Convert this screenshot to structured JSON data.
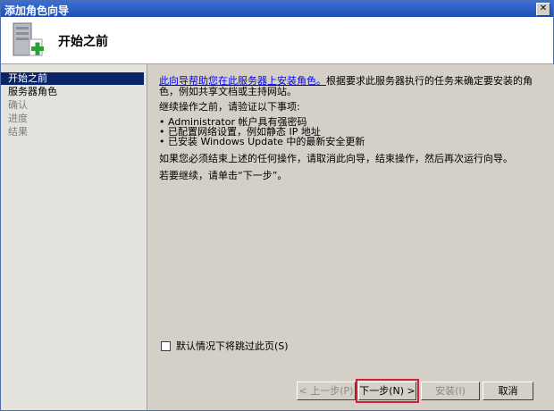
{
  "window": {
    "title": "添加角色向导",
    "close_glyph": "✕"
  },
  "header": {
    "page_title": "开始之前"
  },
  "nav": {
    "items": [
      {
        "label": "开始之前",
        "state": "active"
      },
      {
        "label": "服务器角色",
        "state": "normal"
      },
      {
        "label": "确认",
        "state": "disabled"
      },
      {
        "label": "进度",
        "state": "disabled"
      },
      {
        "label": "结果",
        "state": "disabled"
      }
    ]
  },
  "content": {
    "intro_link": "此向导帮助您在此服务器上安装角色。",
    "intro_text": "根据要求此服务器执行的任务来确定要安装的角色，例如共享文档或主持网站。",
    "verify_heading": "继续操作之前，请验证以下事项:",
    "bullets": [
      "Administrator 帐户具有强密码",
      "已配置网络设置，例如静态 IP 地址",
      "已安装 Windows Update 中的最新安全更新"
    ],
    "cancel_note": "如果您必须结束上述的任何操作，请取消此向导，结束操作，然后再次运行向导。",
    "continue_note": "若要继续，请单击“下一步”。",
    "skip_label": "默认情况下将跳过此页(S)",
    "skip_checked": false
  },
  "buttons": {
    "prev": "< 上一步(P)",
    "next": "下一步(N) >",
    "install": "安装(I)",
    "cancel": "取消"
  },
  "colors": {
    "accent": "#0a246a",
    "highlight": "#d0203a",
    "titlebar": "#2a5ec6"
  }
}
